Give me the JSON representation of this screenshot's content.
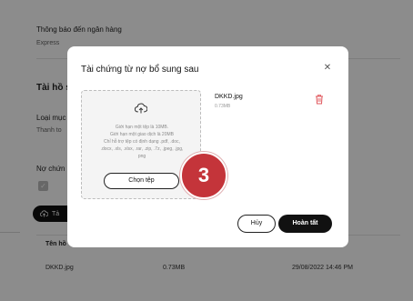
{
  "background": {
    "bank_notice_label": "Thông báo đến ngân hàng",
    "bank_notice_value": "Express",
    "section_title": "Tài hồ s",
    "loan_label": "Loại mục",
    "loan_value": "Thanh to",
    "debt_label": "Nợ chứn",
    "upload_button": "Tả",
    "table_header_name": "Tên hồ",
    "table_row": {
      "name": "DKKD.jpg",
      "size": "0.73MB",
      "date": "29/08/2022 14:46 PM"
    }
  },
  "modal": {
    "title": "Tài chứng từ nợ bổ sung sau",
    "close_icon": "close-icon",
    "dropzone": {
      "icon": "cloud-upload-icon",
      "lines": [
        "Giới hạn một tệp là 10MB.",
        "Giới hạn một giao dịch là 20MB",
        "Chỉ hỗ trợ tệp có định dạng .pdf, .doc,",
        ".docx, .xls, .xlsx, .rar, .zip, .7z, .jpeg, .jpg,",
        "png"
      ],
      "choose_button": "Chọn tệp"
    },
    "file": {
      "name": "DKKD.jpg",
      "size": "0.73MB",
      "delete_icon": "trash-icon"
    },
    "step_badge": "3",
    "cancel_button": "Hủy",
    "done_button": "Hoàn tất"
  },
  "colors": {
    "accent_red": "#c4343a",
    "primary_dark": "#111111"
  }
}
